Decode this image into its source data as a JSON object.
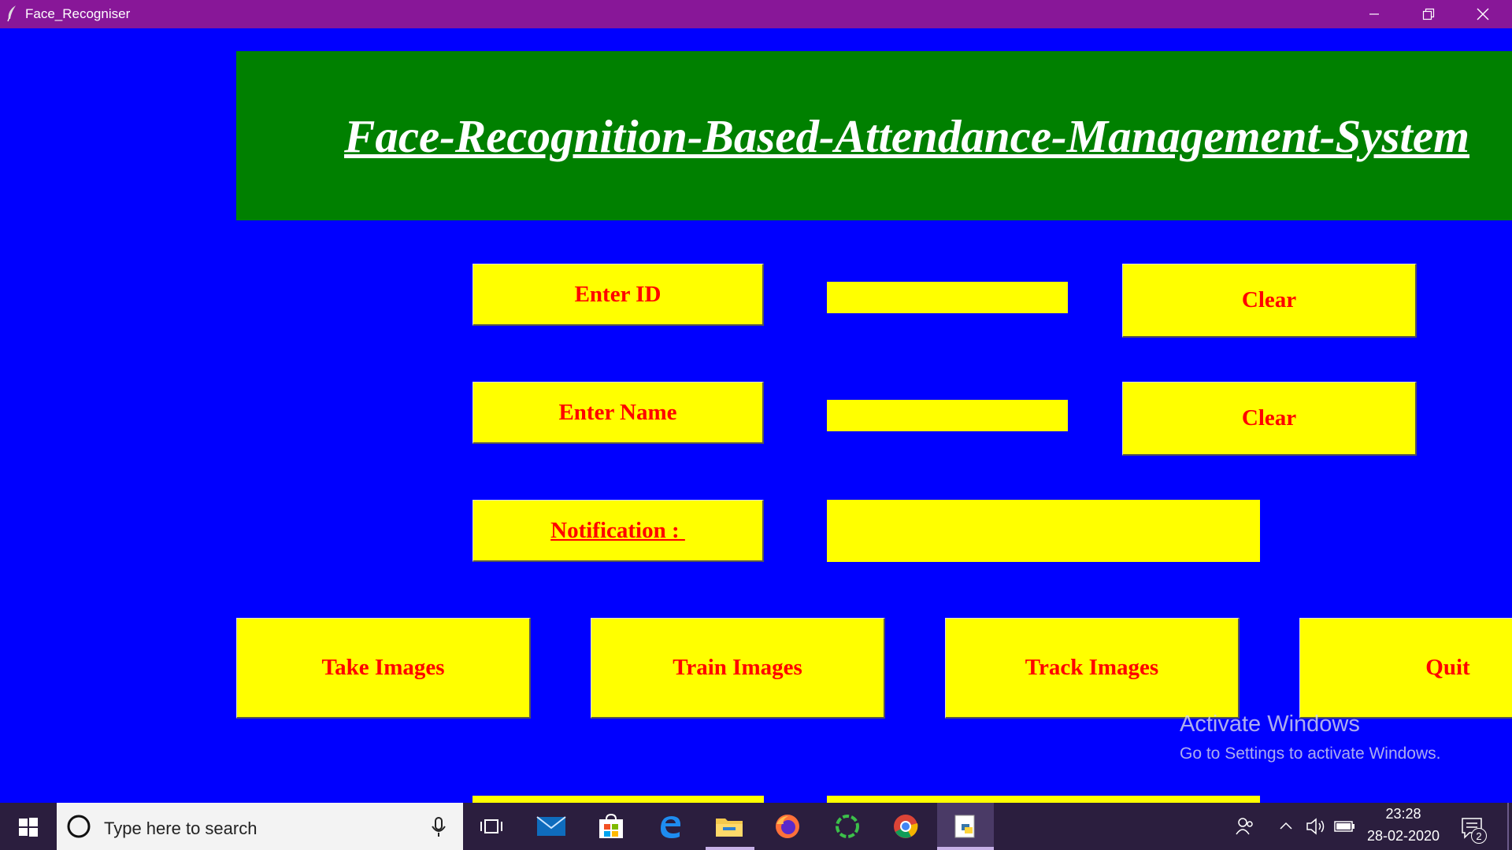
{
  "window": {
    "title": "Face_Recogniser"
  },
  "header": {
    "title": "Face-Recognition-Based-Attendance-Management-System"
  },
  "form": {
    "id_label": "Enter ID",
    "id_value": "",
    "name_label": "Enter Name",
    "name_value": "",
    "clear_id_label": "Clear",
    "clear_name_label": "Clear",
    "notification_label": "Notification : ",
    "notification_value": ""
  },
  "actions": {
    "take_images": "Take Images",
    "train_images": "Train Images",
    "track_images": "Track Images",
    "quit": "Quit"
  },
  "watermark": {
    "line1": "Activate Windows",
    "line2": "Go to Settings to activate Windows."
  },
  "taskbar": {
    "search_placeholder": "Type here to search",
    "time": "23:28",
    "date": "28-02-2020",
    "notification_count": "2",
    "apps": [
      "task-view-icon",
      "mail-icon",
      "store-icon",
      "edge-icon",
      "file-explorer-icon",
      "firefox-icon",
      "loader-app-icon",
      "chrome-icon",
      "python-app-icon"
    ]
  },
  "colors": {
    "background": "#0000FF",
    "header": "#008000",
    "box": "#FFFF00",
    "box_text": "#FF0000",
    "titlebar": "#881798"
  }
}
